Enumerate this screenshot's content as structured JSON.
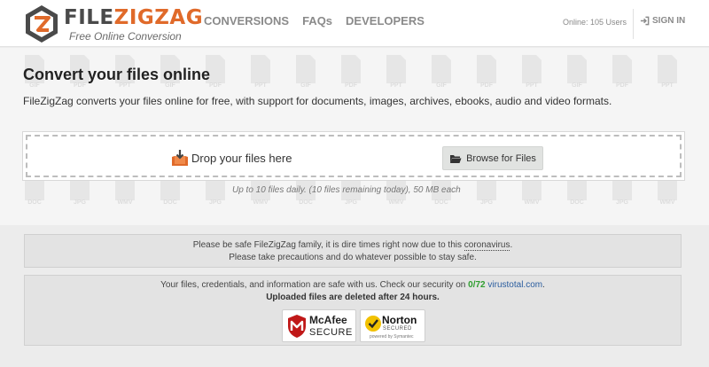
{
  "header": {
    "logo": {
      "wordmark_a": "FILE",
      "wordmark_b": "ZIGZAG",
      "tagline": "Free Online Conversion"
    },
    "nav": [
      {
        "label": "CONVERSIONS"
      },
      {
        "label": "FAQs"
      },
      {
        "label": "DEVELOPERS"
      }
    ],
    "online_status": "Online: 105 Users",
    "sign_in": {
      "label": "SIGN IN",
      "icon": "sign-in-icon"
    }
  },
  "main": {
    "title": "Convert your files online",
    "description": "FileZigZag converts your files online for free, with support for documents, images, archives, ebooks, audio and video formats.",
    "dropzone": {
      "drop_label": "Drop your files here",
      "drop_icon": "download-box-icon",
      "browse_label": "Browse for Files",
      "browse_icon": "folder-open-icon"
    },
    "limit_text": "Up to 10 files daily. (10 files remaining today), 50 MB each",
    "background_file_types": [
      "GIF",
      "PDF",
      "PPT",
      "DOC",
      "JPG",
      "WMV"
    ]
  },
  "notice": {
    "line1_prefix": "Please be safe FileZigZag family, it is dire times right now due to this ",
    "line1_link": "coronavirus",
    "line1_suffix": ".",
    "line2": "Please take precautions and do whatever possible to stay safe."
  },
  "security": {
    "line1_prefix": "Your files, credentials, and information are safe with us. Check our security on ",
    "score": "0/72",
    "link": "virustotal.com",
    "line1_suffix": ".",
    "line2": "Uploaded files are deleted after 24 hours.",
    "mcafee": {
      "name": "McAfee",
      "sub": "SECURE"
    },
    "norton": {
      "name": "Norton",
      "sub": "SECURED",
      "powered": "powered by Symantec"
    }
  },
  "colors": {
    "accent": "#e06a2a",
    "link": "#2a5d9f",
    "score": "#2f9e2f"
  }
}
